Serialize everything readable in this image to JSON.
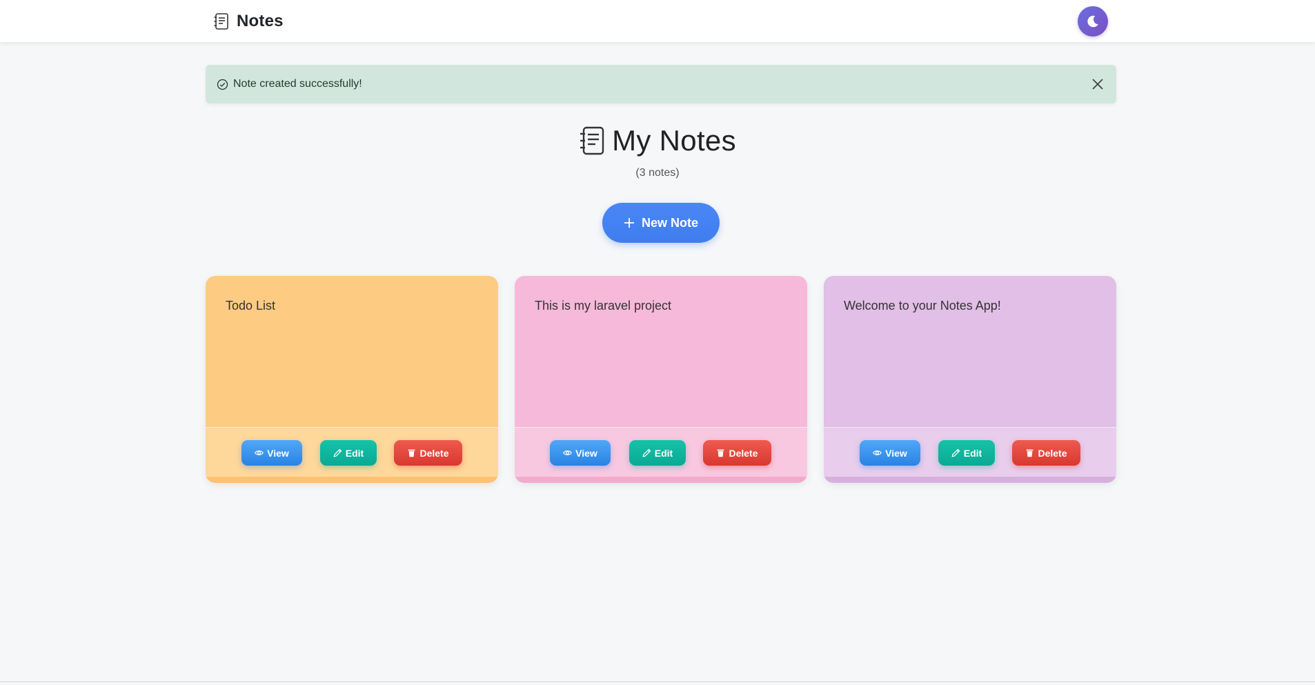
{
  "navbar": {
    "brand": "Notes",
    "brand_icon": "journal-text-icon",
    "theme_toggle_icon": "moon-icon",
    "theme_toggle_color": "#6f5fd6"
  },
  "alert": {
    "message": "Note created successfully!",
    "icon": "check-circle-icon",
    "close_icon": "close-icon",
    "background": "#d1e7dd"
  },
  "header": {
    "title": "My Notes",
    "count": "(3 notes)",
    "icon": "journal-text-icon"
  },
  "new_note": {
    "label": "New Note",
    "icon": "plus-icon",
    "color": "#4284f3"
  },
  "notes": [
    {
      "text": "Todo List",
      "color": "#fdcb82",
      "footer_color": "#fed79b",
      "strip_color": "#fcc274"
    },
    {
      "text": "This is my laravel project",
      "color": "#f6b9d9",
      "footer_color": "#f8c8e1",
      "strip_color": "#f2aacd"
    },
    {
      "text": "Welcome to your Notes App!",
      "color": "#e1bfe6",
      "footer_color": "#e8cdec",
      "strip_color": "#d7b0de"
    }
  ],
  "actions": {
    "view": "View",
    "edit": "Edit",
    "delete": "Delete",
    "view_icon": "eye-icon",
    "edit_icon": "pencil-icon",
    "delete_icon": "trash-icon"
  }
}
